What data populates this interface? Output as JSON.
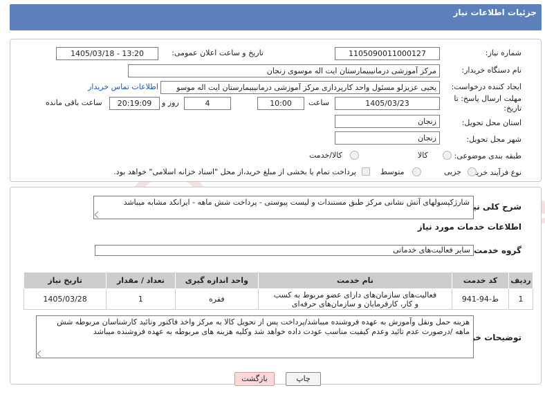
{
  "header": {
    "title": "جزئیات اطلاعات نیاز"
  },
  "form": {
    "need_number_label": "شماره نیاز:",
    "need_number": "1105090011000127",
    "announce_label": "تاریخ و ساعت اعلان عمومی:",
    "announce_value": "1405/03/18 - 13:20",
    "buyer_org_label": "نام دستگاه خریدار:",
    "buyer_org": "مرکز آموزشی درمانیبیمارستان ایت اله موسوی زنجان",
    "requester_label": "ایجاد کننده درخواست:",
    "requester": "یحیی عزیزلو مسئول واحد کارپردازی مرکز آموزشی درمانیبیمارستان ایت اله موسو",
    "contact_link": "اطلاعات تماس خریدار",
    "deadline_label": "مهلت ارسال پاسخ: تا تاریخ:",
    "deadline_date": "1405/03/23",
    "time_label": "ساعت",
    "deadline_time": "10:00",
    "days_count": "4",
    "days_label": "روز و",
    "remaining_time": "20:19:09",
    "remaining_label": "ساعت باقی مانده",
    "province_label": "استان محل تحویل:",
    "province": "زنجان",
    "city_label": "شهر محل تحویل:",
    "city": "زنجان",
    "category_label": "طبقه بندی موضوعی:",
    "category_options": [
      "کالا",
      "کالا/خدمت"
    ],
    "purchase_type_label": "نوع فرآیند خرید :",
    "purchase_options": [
      "جزیی",
      "متوسط"
    ],
    "payment_note": "پرداخت تمام یا بخشی از مبلغ خرید،از محل \"اسناد خزانه اسلامی\" خواهد بود."
  },
  "description": {
    "label": "شرح کلی نیاز:",
    "text": "شارژکپسولهای آتش نشانی مرکز طبق مستندات و لیست پیوستی - پرداخت شش ماهه - ایرانکد مشابه میباشد"
  },
  "services": {
    "section_title": "اطلاعات خدمات مورد نیاز",
    "group_label": "گروه خدمت:",
    "group_value": "سایر فعالیت‌های خدماتی",
    "columns": [
      "ردیف",
      "کد خدمت",
      "نام خدمت",
      "واحد اندازه گیری",
      "تعداد / مقدار",
      "تاریخ نیاز"
    ],
    "rows": [
      {
        "index": "1",
        "code": "ط-94-941",
        "name": "فعالیت‌های سازمان‌های دارای عضو مربوط به کسب و کار، کارفرمایان و سازمان‌های حرفه‌ای",
        "unit": "فقره",
        "qty": "1",
        "date": "1405/03/28"
      }
    ]
  },
  "buyer_notes": {
    "label": "توضیحات خریدار:",
    "text": "هزینه حمل ونقل وآموزش به عهده فروشنده میباشد/پرداخت پس از تحویل کالا به مرکز واخذ فاکتور وتائید کارشناسان مربوطه شش ماهه /درصورت عدم تائید وعدم کیفیت مناسب عودت داده خواهد شد وکلیه هزینه های مربوطه به عهده فروشنده میباشد"
  },
  "buttons": {
    "print": "چاپ",
    "back": "بازگشت"
  },
  "watermark": {
    "text": "AriaTender.neT"
  },
  "colors": {
    "header": "#5b80ba",
    "link": "#1f57b5",
    "back_button": "#fbd9d9"
  }
}
